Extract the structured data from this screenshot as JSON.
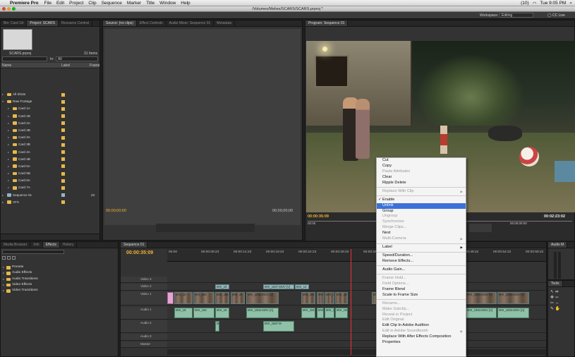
{
  "menubar": {
    "app": "Premiere Pro",
    "items": [
      "File",
      "Edit",
      "Project",
      "Clip",
      "Sequence",
      "Marker",
      "Title",
      "Window",
      "Help"
    ],
    "battery": "(10)",
    "clock": "Tue 9:05 PM"
  },
  "window": {
    "title": "/Volumes/Melies/SCARS/SCARS.prproj *"
  },
  "workspace": {
    "label": "Workspace:",
    "value": "Editing",
    "cc": "CC Live"
  },
  "project": {
    "tabs": [
      "Bin: Card 1A",
      "Project: SCARS",
      "Resource Central"
    ],
    "name": "SCARS.prproj",
    "count": "31 Items",
    "in_label": "In:",
    "in_value": "All",
    "col_name": "Name",
    "col_label": "Label",
    "col_frame": "Frame",
    "bins": [
      {
        "name": "All Shots",
        "indent": 0
      },
      {
        "name": "Raw Footage",
        "indent": 0,
        "open": true
      },
      {
        "name": "Card 1A",
        "indent": 1
      },
      {
        "name": "Card 1B",
        "indent": 1
      },
      {
        "name": "Card 2A",
        "indent": 1
      },
      {
        "name": "Card 2B",
        "indent": 1
      },
      {
        "name": "Card 3A",
        "indent": 1
      },
      {
        "name": "Card 3B",
        "indent": 1
      },
      {
        "name": "Card 4A",
        "indent": 1
      },
      {
        "name": "Card 4B",
        "indent": 1
      },
      {
        "name": "Card 5A",
        "indent": 1
      },
      {
        "name": "Card 5B",
        "indent": 1
      },
      {
        "name": "Card 6A",
        "indent": 1
      },
      {
        "name": "Card 7A",
        "indent": 1
      },
      {
        "name": "Sequence 01",
        "indent": 0,
        "seq": true,
        "frames": "23"
      },
      {
        "name": "VFX",
        "indent": 0
      }
    ]
  },
  "source": {
    "tabs": [
      "Source: (no clips)",
      "Effect Controls",
      "Audio Mixer: Sequence 01",
      "Metadata"
    ],
    "tc_left": "00;00;00;00",
    "tc_right": "00;00;00;00"
  },
  "program": {
    "tab": "Program: Sequence 01",
    "tc_left": "00:00:35:09",
    "tc_right": "00:02:23:02",
    "ruler_left": "00:00",
    "ruler_right": "00:05:00:00"
  },
  "effects": {
    "tabs": [
      "Media Browser",
      "Info",
      "Effects",
      "History"
    ],
    "items": [
      "Presets",
      "Audio Effects",
      "Audio Transitions",
      "Video Effects",
      "Video Transitions"
    ]
  },
  "timeline": {
    "tab": "Sequence 01",
    "tc": "00:00:35:09",
    "ruler": [
      "00:00",
      "00:00:09:23",
      "00:00:14:23",
      "00:00:19:23",
      "00:00:24:23",
      "00:00:29:23",
      "00:00:34:23",
      "00:00:39:23",
      "00:00:44:22",
      "00:00:49:22",
      "00:00:54:22",
      "00:00:59:22"
    ],
    "tracks": {
      "v3": "Video 3",
      "v2": "Video 2",
      "v1": "Video 1",
      "a1": "Audio 1",
      "a2": "Audio 2",
      "a3": "Audio 3",
      "master": "Master"
    },
    "clips_v2": [
      "MVI_19",
      "MVI_1937.MOV [V]",
      "MVI_13"
    ],
    "clips_v1": [
      "MVI_19",
      "MVI_194",
      "MVI_194",
      "MVI_19",
      "MVI_1932.MOV [V]",
      "MVI_194",
      "MVI_19",
      "MVI_193",
      "MVI_194",
      "MVI_194",
      "MVI_1934.MOV [V]",
      "MVI_1934.MOV [V]"
    ],
    "clips_a1": [
      "MVI_19",
      "MVI_194",
      "MVI_19",
      "MVI_1932.MOV [A]",
      "MVI_194",
      "MVI_19",
      "MVI_193",
      "MVI_194",
      "MVI_1934.MOV [A]",
      "MVI_1934.MOV [A]"
    ],
    "clips_a2": [
      "M",
      "MVI_1937.M"
    ]
  },
  "audio_panel": {
    "tab": "Audio M"
  },
  "tools_panel": {
    "tab": "Tools"
  },
  "context_menu": {
    "items": [
      {
        "label": "Cut"
      },
      {
        "label": "Copy"
      },
      {
        "label": "Paste Attributes",
        "disabled": true
      },
      {
        "label": "Clear"
      },
      {
        "label": "Ripple Delete"
      },
      {
        "sep": true
      },
      {
        "label": "Replace With Clip",
        "disabled": true,
        "sub": true
      },
      {
        "sep": true
      },
      {
        "label": "Enable",
        "checked": true
      },
      {
        "label": "Unlink",
        "selected": true
      },
      {
        "label": "Group"
      },
      {
        "label": "Ungroup",
        "disabled": true
      },
      {
        "label": "Synchronize",
        "disabled": true
      },
      {
        "label": "Merge Clips...",
        "disabled": true
      },
      {
        "label": "Nest"
      },
      {
        "label": "Multi-Camera",
        "disabled": true,
        "sub": true
      },
      {
        "sep": true
      },
      {
        "label": "Label",
        "sub": true
      },
      {
        "sep": true
      },
      {
        "label": "Speed/Duration..."
      },
      {
        "label": "Remove Effects..."
      },
      {
        "sep": true
      },
      {
        "label": "Audio Gain..."
      },
      {
        "sep": true
      },
      {
        "label": "Frame Hold...",
        "disabled": true
      },
      {
        "label": "Field Options...",
        "disabled": true
      },
      {
        "label": "Frame Blend"
      },
      {
        "label": "Scale to Frame Size"
      },
      {
        "sep": true
      },
      {
        "label": "Rename...",
        "disabled": true
      },
      {
        "label": "Make Subclip...",
        "disabled": true
      },
      {
        "label": "Reveal in Project",
        "disabled": true
      },
      {
        "label": "Edit Original",
        "disabled": true
      },
      {
        "label": "Edit Clip In Adobe Audition"
      },
      {
        "label": "Edit in Adobe Soundbooth",
        "disabled": true,
        "sub": true
      },
      {
        "label": "Replace With After Effects Composition"
      },
      {
        "label": "Properties"
      }
    ]
  }
}
